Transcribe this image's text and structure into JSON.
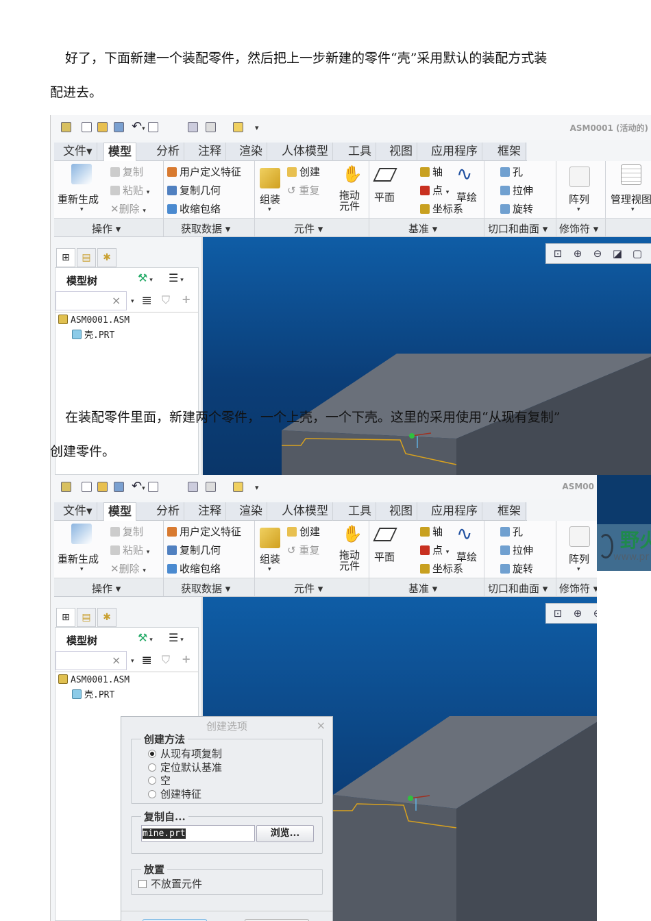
{
  "doc": {
    "para1_line1": "好了，下面新建一个装配零件，然后把上一步新建的零件“壳”采用默认的装配方式装",
    "para1_line2": "配进去。",
    "para2_line1": "在装配零件里面，新建两个零件，一个上壳，一个下壳。这里的采用使用“从现有复制”",
    "para2_line2": "创建零件。"
  },
  "ui": {
    "title_shot1": "ASM0001 (活动的)",
    "title_shot2": "ASM00",
    "tabs": [
      "文件▾",
      "模型",
      "分析",
      "注释",
      "渲染",
      "人体模型",
      "工具",
      "视图",
      "应用程序",
      "框架"
    ],
    "active_tab": "模型",
    "ops": {
      "regen": "重新生成",
      "copy": "复制",
      "paste": "粘贴",
      "delete": "删除"
    },
    "getdata": {
      "udf": "用户定义特征",
      "copygeom": "复制几何",
      "shrinkwrap": "收缩包络"
    },
    "component": {
      "assemble": "组装",
      "create": "创建",
      "repeat": "重复",
      "drag1": "拖动",
      "drag2": "元件"
    },
    "datum": {
      "plane": "平面",
      "axis": "轴",
      "point": "点",
      "csys": "坐标系",
      "sketch": "草绘"
    },
    "cut": {
      "hole": "孔",
      "extrude": "拉伸",
      "revolve": "旋转"
    },
    "pattern": "阵列",
    "manage_views": "管理视图",
    "groups": [
      "操作 ▾",
      "获取数据 ▾",
      "元件 ▾",
      "基准 ▾",
      "切口和曲面 ▾",
      "修饰符 ▾"
    ],
    "model_tree": "模型树",
    "tree": [
      "ASM0001.ASM",
      "壳.PRT"
    ],
    "search_placeholder": ""
  },
  "dialog": {
    "title": "创建选项",
    "method_legend": "创建方法",
    "methods": [
      "从现有项复制",
      "定位默认基准",
      "空",
      "创建特征"
    ],
    "selected_method": 0,
    "copyfrom_legend": "复制自...",
    "copyfrom_value": "mine.prt",
    "browse": "浏览...",
    "placement_legend": "放置",
    "no_place": "不放置元件",
    "no_place_checked": false
  },
  "watermark": {
    "brand": "野火",
    "url": "www.pr"
  },
  "colors": {
    "viewport_top": "#0f5da6",
    "viewport_bottom": "#0a3669",
    "part_gray": "#5b616c",
    "edge_orange": "#d9a21e"
  }
}
